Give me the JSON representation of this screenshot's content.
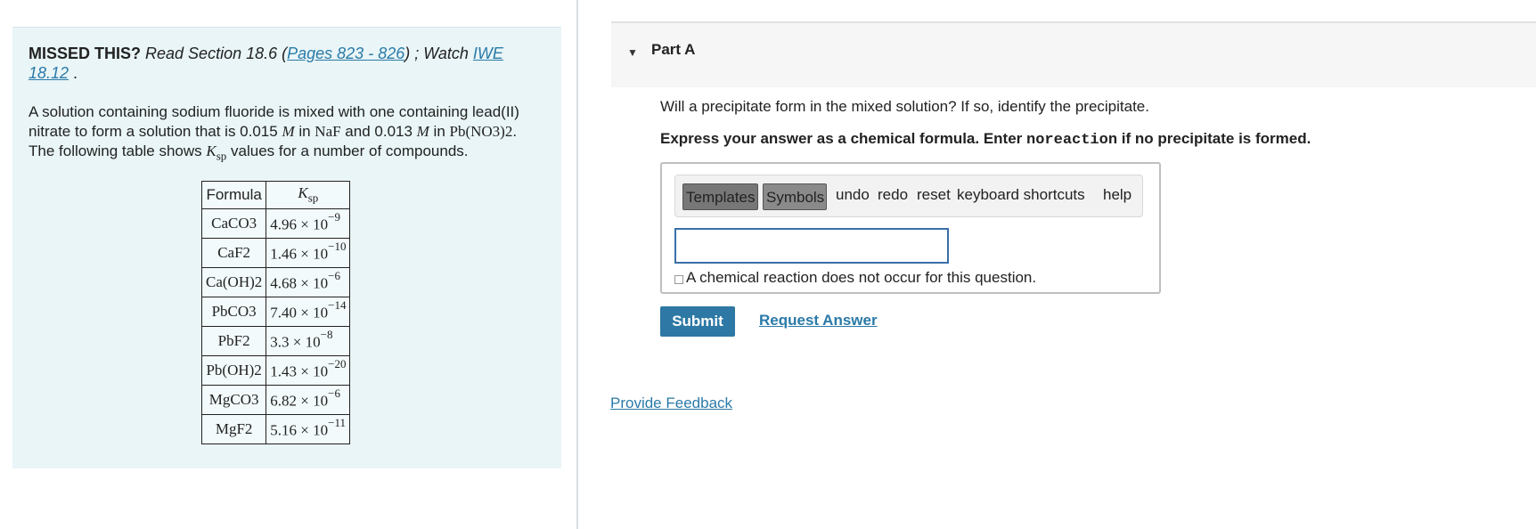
{
  "intro": {
    "missed_label": "MISSED THIS?",
    "read_text": " Read Section 18.6 (",
    "pages_link": "Pages 823 - 826",
    "watch_text": ") ; Watch ",
    "iwe_link": "IWE 18.12",
    "end_period": " ."
  },
  "problem": {
    "t1": "A solution containing sodium fluoride is mixed with one containing lead(II) nitrate to form a solution that is 0.015 ",
    "m1": "M",
    "t2": " in ",
    "naf": "NaF",
    "t3": " and 0.013 ",
    "m2": "M",
    "t4": " in ",
    "pbno3": "Pb(NO3)2",
    "t5": ". The following table shows ",
    "ksp_k": "K",
    "ksp_sub": "sp",
    "t6": " values for a number of compounds."
  },
  "table": {
    "header_formula": "Formula",
    "header_k": "K",
    "header_sub": "sp",
    "rows": [
      {
        "formula": "CaCO3",
        "mantissa": "4.96 × 10",
        "exp": "−9"
      },
      {
        "formula": "CaF2",
        "mantissa": "1.46 × 10",
        "exp": "−10"
      },
      {
        "formula": "Ca(OH)2",
        "mantissa": "4.68 × 10",
        "exp": "−6"
      },
      {
        "formula": "PbCO3",
        "mantissa": "7.40 × 10",
        "exp": "−14"
      },
      {
        "formula": "PbF2",
        "mantissa": "3.3 × 10",
        "exp": "−8"
      },
      {
        "formula": "Pb(OH)2",
        "mantissa": "1.43 × 10",
        "exp": "−20"
      },
      {
        "formula": "MgCO3",
        "mantissa": "6.82 × 10",
        "exp": "−6"
      },
      {
        "formula": "MgF2",
        "mantissa": "5.16 × 10",
        "exp": "−11"
      }
    ]
  },
  "part": {
    "caret_icon": "caret-down-icon",
    "title": "Part A"
  },
  "question": "Will a precipitate form in the mixed solution? If so, identify the precipitate.",
  "instruction": {
    "before": "Express your answer as a chemical formula. Enter ",
    "code": "noreaction",
    "after": " if no precipitate is formed."
  },
  "toolbar": {
    "templates": "Templates",
    "symbols": "Symbols",
    "undo": "undo",
    "redo": "redo",
    "reset": "reset",
    "shortcuts": "keyboard shortcuts",
    "help": "help"
  },
  "answer": {
    "value": "",
    "no_reaction_label": "A chemical reaction does not occur for this question."
  },
  "actions": {
    "submit": "Submit",
    "request_answer": "Request Answer"
  },
  "feedback": "Provide Feedback",
  "colors": {
    "panel_bg": "#e9f5f7",
    "link": "#2a7aa8",
    "submit_bg": "#2d78a4"
  }
}
